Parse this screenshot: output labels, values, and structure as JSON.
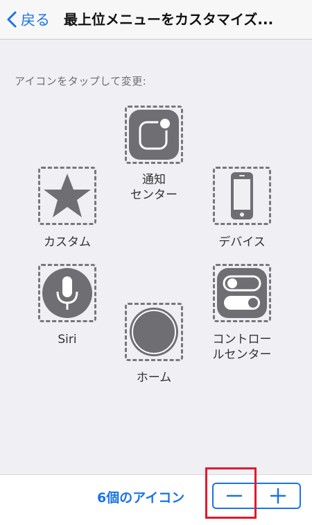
{
  "nav": {
    "back_label": "戻る",
    "title": "最上位メニューをカスタマイズ..."
  },
  "instruction": "アイコンをタップして変更:",
  "icons": {
    "notification": "通知\nセンター",
    "custom": "カスタム",
    "device": "デバイス",
    "siri": "Siri",
    "control": "コントロー\nルセンター",
    "home": "ホーム"
  },
  "bottom": {
    "count_label": "6個のアイコン",
    "minus_label": "−",
    "plus_label": "+"
  },
  "colors": {
    "accent": "#1a73e8",
    "icon_gray": "#6e6e73",
    "highlight": "#e3182d"
  }
}
